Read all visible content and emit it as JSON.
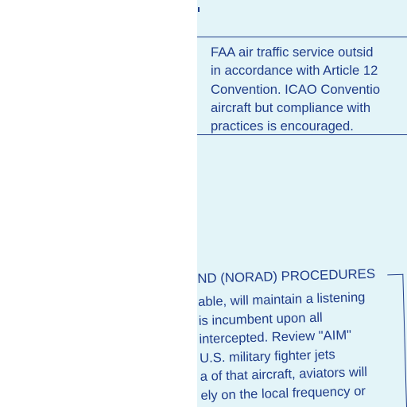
{
  "faa_paragraph": {
    "lines": [
      "FAA air traffic service outsid",
      "in accordance with Article 12",
      "Convention. ICAO Conventio",
      "aircraft but compliance with",
      "practices is encouraged."
    ]
  },
  "norad_section": {
    "heading": "ND (NORAD) PROCEDURES",
    "lines": [
      "able, will maintain a listening",
      "is incumbent upon all",
      "intercepted. Review \"AIM\"",
      "U.S. military fighter jets",
      "a of that aircraft, aviators will",
      "ely on the local frequency or"
    ]
  },
  "colors": {
    "page_tint": "#e3f4f8",
    "ink": "#1f3c88"
  }
}
